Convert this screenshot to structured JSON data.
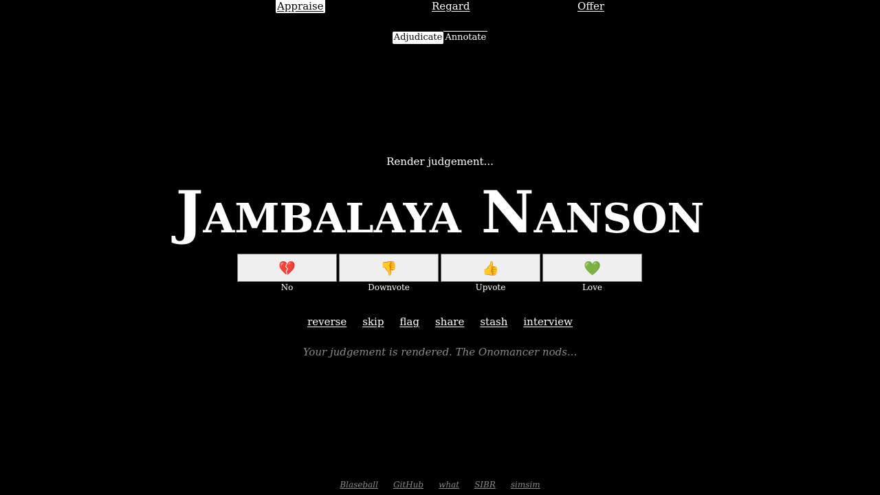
{
  "nav": {
    "primary": [
      "Appraise",
      "Regard",
      "Offer"
    ],
    "secondary": [
      "Adjudicate",
      "Annotate"
    ]
  },
  "main": {
    "prompt": "Render judgement...",
    "name": "Jambalaya Nanson",
    "votes": [
      {
        "icon": "broken-heart-icon",
        "glyph": "💔",
        "label": "No"
      },
      {
        "icon": "thumbs-down-icon",
        "glyph": "👎",
        "label": "Downvote"
      },
      {
        "icon": "thumbs-up-icon",
        "glyph": "👍",
        "label": "Upvote"
      },
      {
        "icon": "green-heart-icon",
        "glyph": "💚",
        "label": "Love"
      }
    ],
    "actions": [
      "reverse",
      "skip",
      "flag",
      "share",
      "stash",
      "interview"
    ],
    "status": "Your judgement is rendered. The Onomancer nods..."
  },
  "footer": {
    "links": [
      "Blaseball",
      "GitHub",
      "what",
      "SIBR",
      "simsim"
    ]
  }
}
